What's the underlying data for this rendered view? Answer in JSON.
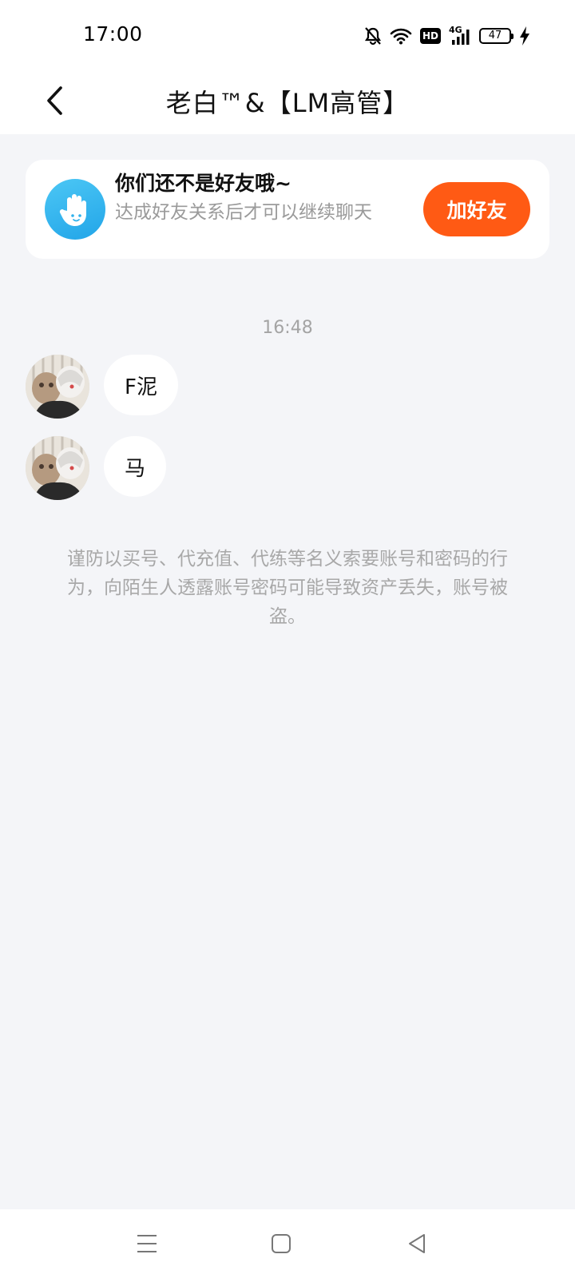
{
  "status_bar": {
    "time": "17:00",
    "network_label": "4G",
    "hd_label": "HD",
    "battery_level": "47",
    "icons": [
      "bell-muted-icon",
      "wifi-icon",
      "hd-icon",
      "cellular-signal-icon",
      "battery-icon",
      "charging-bolt-icon"
    ]
  },
  "header": {
    "title": "老白™&【LM高管】",
    "back_icon": "chevron-left-icon"
  },
  "friend_notice": {
    "title": "你们还不是好友哦~",
    "description": "达成好友关系后才可以继续聊天",
    "add_button_label": "加好友",
    "avatar_icon": "waving-hand-icon"
  },
  "chat": {
    "timestamp": "16:48",
    "messages": [
      {
        "text": "F泥",
        "sender": "other"
      },
      {
        "text": "马",
        "sender": "other"
      }
    ],
    "safety_tip": "谨防以买号、代充值、代练等名义索要账号和密码的行为，向陌生人透露账号密码可能导致资产丢失，账号被盗。"
  },
  "system_nav": {
    "icons": [
      "menu-icon",
      "home-square-icon",
      "back-triangle-icon"
    ]
  },
  "colors": {
    "accent": "#ff5a14",
    "hand_avatar": "#2fb1ec",
    "background": "#f4f5f8"
  }
}
